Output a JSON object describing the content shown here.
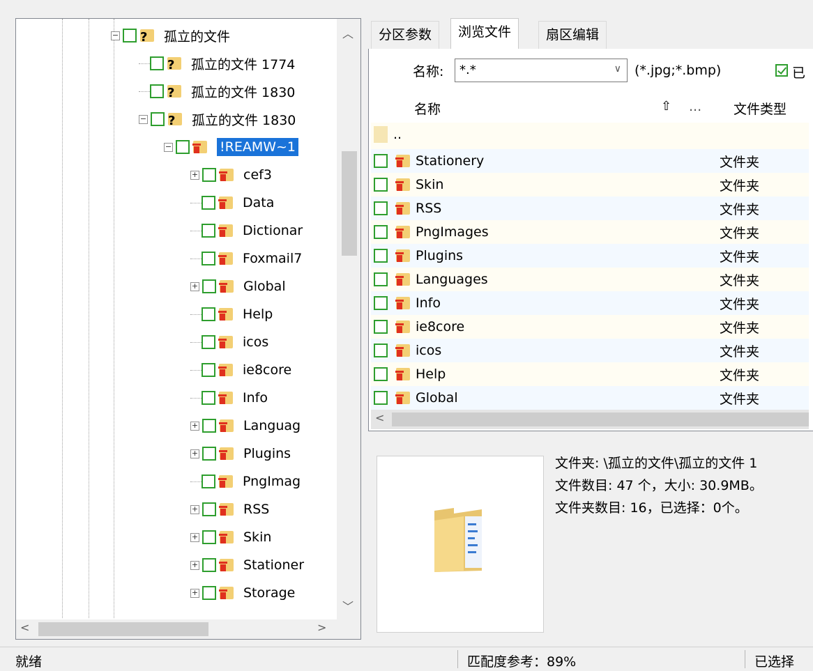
{
  "tree": {
    "rows": [
      {
        "label": "孤立的文件",
        "icon": "question-folder-icon",
        "expander": "minus"
      },
      {
        "label": "孤立的文件 1774",
        "icon": "question-folder-icon",
        "expander": "none"
      },
      {
        "label": "孤立的文件 1830",
        "icon": "question-folder-icon",
        "expander": "none"
      },
      {
        "label": "孤立的文件 1830",
        "icon": "question-folder-icon",
        "expander": "minus"
      },
      {
        "label": "!REAMW~1",
        "icon": "deleted-folder-icon",
        "expander": "minus",
        "selected": true
      },
      {
        "label": "cef3",
        "icon": "deleted-folder-icon",
        "expander": "plus"
      },
      {
        "label": "Data",
        "icon": "deleted-folder-icon",
        "expander": "none"
      },
      {
        "label": "Dictionar",
        "icon": "deleted-folder-icon",
        "expander": "none"
      },
      {
        "label": "Foxmail7",
        "icon": "deleted-folder-icon",
        "expander": "none"
      },
      {
        "label": "Global",
        "icon": "deleted-folder-icon",
        "expander": "plus"
      },
      {
        "label": "Help",
        "icon": "deleted-folder-icon",
        "expander": "none"
      },
      {
        "label": "icos",
        "icon": "deleted-folder-icon",
        "expander": "none"
      },
      {
        "label": "ie8core",
        "icon": "deleted-folder-icon",
        "expander": "none"
      },
      {
        "label": "Info",
        "icon": "deleted-folder-icon",
        "expander": "none"
      },
      {
        "label": "Languag",
        "icon": "deleted-folder-icon",
        "expander": "plus"
      },
      {
        "label": "Plugins",
        "icon": "deleted-folder-icon",
        "expander": "plus"
      },
      {
        "label": "PngImag",
        "icon": "deleted-folder-icon",
        "expander": "none"
      },
      {
        "label": "RSS",
        "icon": "deleted-folder-icon",
        "expander": "plus"
      },
      {
        "label": "Skin",
        "icon": "deleted-folder-icon",
        "expander": "plus"
      },
      {
        "label": "Stationer",
        "icon": "deleted-folder-icon",
        "expander": "plus"
      },
      {
        "label": "Storage",
        "icon": "deleted-folder-icon",
        "expander": "plus"
      }
    ]
  },
  "tabs": [
    {
      "label": "分区参数",
      "active": false
    },
    {
      "label": "浏览文件",
      "active": true
    },
    {
      "label": "扇区编辑",
      "active": false
    }
  ],
  "filter": {
    "name_label": "名称:",
    "name_value": "*.*",
    "ext_hint": "(*.jpg;*.bmp)",
    "checkbox_label": "已"
  },
  "list": {
    "col_name": "名称",
    "col_more": "...",
    "col_type": "文件类型",
    "parent_label": "..",
    "rows": [
      {
        "name": "Stationery",
        "type": "文件夹"
      },
      {
        "name": "Skin",
        "type": "文件夹"
      },
      {
        "name": "RSS",
        "type": "文件夹"
      },
      {
        "name": "PngImages",
        "type": "文件夹"
      },
      {
        "name": "Plugins",
        "type": "文件夹"
      },
      {
        "name": "Languages",
        "type": "文件夹"
      },
      {
        "name": "Info",
        "type": "文件夹"
      },
      {
        "name": "ie8core",
        "type": "文件夹"
      },
      {
        "name": "icos",
        "type": "文件夹"
      },
      {
        "name": "Help",
        "type": "文件夹"
      },
      {
        "name": "Global",
        "type": "文件夹"
      }
    ]
  },
  "info": {
    "line1": "文件夹: \\孤立的文件\\孤立的文件 1",
    "line2": "文件数目: 47 个，大小: 30.9MB。",
    "line3": "文件夹数目: 16，已选择：0个。"
  },
  "status": {
    "ready": "就绪",
    "match": "匹配度参考：89%",
    "selected": "已选择"
  },
  "colors": {
    "selection": "#1a73d9",
    "checkbox_border": "#2e9e2e",
    "folder": "#f3cf74",
    "deleted_marker": "#e0301e"
  }
}
